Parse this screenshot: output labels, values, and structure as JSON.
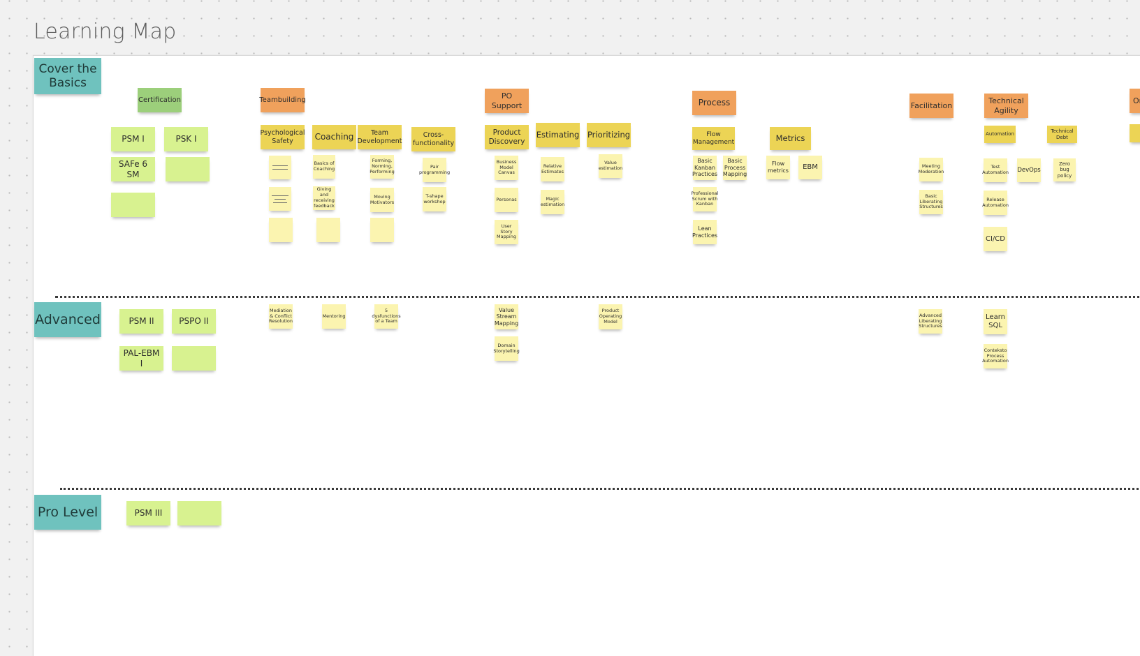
{
  "board": {
    "title": "Learning Map"
  },
  "lanes": {
    "basics": "Cover the Basics",
    "advanced": "Advanced",
    "pro": "Pro Level"
  },
  "colors": {
    "lane_label": "#6fc2be",
    "certification_header": "#9ccf7b",
    "certification_note": "#d8f290",
    "category_header": "#f0a15c",
    "topic_header": "#ecd455",
    "topic_note": "#fbf4b0"
  },
  "basics": {
    "certification": {
      "header": "Certification",
      "notes": [
        "PSM I",
        "PSK I",
        "SAFe 6 SM",
        "",
        ""
      ]
    },
    "teambuilding": {
      "header": "Teambuilding",
      "topics": {
        "psych_safety": {
          "label": "Psychological Safety",
          "notes": [
            "",
            "",
            ""
          ]
        },
        "coaching": {
          "label": "Coaching",
          "notes": [
            "Basics of Coaching",
            "Giving and receiving feedback",
            ""
          ]
        },
        "team_dev": {
          "label": "Team Development",
          "notes": [
            "Forming, Norming, Performing",
            "Moving Motivators",
            ""
          ]
        },
        "cross_func": {
          "label": "Cross-functionality",
          "notes": [
            "Pair programming",
            "T-shape workshop"
          ]
        }
      }
    },
    "po_support": {
      "header": "PO Support",
      "topics": {
        "product_discovery": {
          "label": "Product Discovery",
          "notes": [
            "Business Model Canvas",
            "Personas",
            "User Story Mapping"
          ]
        },
        "estimating": {
          "label": "Estimating",
          "notes": [
            "Relative Estimates",
            "Magic estimation"
          ]
        },
        "prioritizing": {
          "label": "Prioritizing",
          "notes": [
            "Value estimation"
          ]
        }
      }
    },
    "process": {
      "header": "Process",
      "topics": {
        "flow_mgmt": {
          "label": "Flow Management",
          "notes": [
            "Basic Kanban Practices",
            "Basic Process Mapping",
            "Professional Scrum with Kanban",
            "Lean Practices"
          ]
        },
        "metrics": {
          "label": "Metrics",
          "notes": [
            "Flow metrics",
            "EBM"
          ]
        }
      }
    },
    "facilitation": {
      "header": "Facilitation",
      "notes": [
        "Meeting Moderation",
        "Basic Liberating Structures"
      ]
    },
    "technical_agility": {
      "header": "Technical Agility",
      "topics": {
        "automation": {
          "label": "Automation",
          "notes": [
            "Test Automation",
            "DevOps",
            "Release Automation",
            "CI/CD"
          ]
        },
        "tech_debt": {
          "label": "Technical Debt",
          "notes": [
            "Zero bug policy"
          ]
        }
      }
    },
    "organization": {
      "header": "Or"
    }
  },
  "advanced": {
    "certification_notes": [
      "PSM II",
      "PSPO II",
      "PAL-EBM I",
      ""
    ],
    "teambuilding_notes": [
      "Mediation & Conflict Resolution",
      "Mentoring",
      "5 dysfunctions of a Team"
    ],
    "po_notes": [
      "Value Stream Mapping",
      "Domain Storytelling",
      "Product Operating Model"
    ],
    "facilitation_notes": [
      "Advanced Liberating Structures"
    ],
    "technical_notes": [
      "Learn SQL",
      "Conteksto Process Automation"
    ]
  },
  "pro": {
    "certification_notes": [
      "PSM III",
      ""
    ]
  }
}
